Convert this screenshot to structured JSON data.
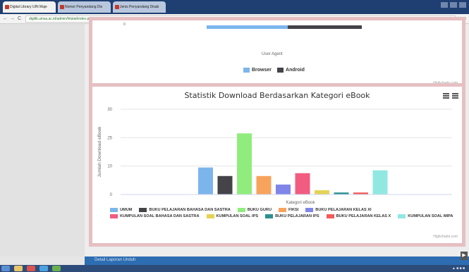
{
  "browser": {
    "tabs": [
      {
        "label": "Digital Library UIN Maje"
      },
      {
        "label": "Nomor Penyandang Dis"
      },
      {
        "label": "Jenis Penyandang Disab"
      }
    ],
    "url": "digilib.uinsa.ac.id/admin/hitstat/index.php?id=98#download",
    "nav": {
      "back": "←",
      "forward": "→",
      "reload": "C"
    },
    "url_icons": "☆ ≡"
  },
  "top_chart": {
    "tick": "0",
    "axis_label": "User Agent",
    "legend": [
      {
        "label": "Browser",
        "color": "#7cb5ec"
      },
      {
        "label": "Android",
        "color": "#434348"
      }
    ],
    "credits": "Highcharts.com"
  },
  "chart_data": {
    "type": "bar",
    "title": "Statistik Download Berdasarkan Kategori eBook",
    "xlabel": "Kategori eBook",
    "ylabel": "Jumlah Download eBook",
    "ylim": [
      0,
      30
    ],
    "yticks": [
      "30",
      "25",
      "10",
      "0"
    ],
    "grid": true,
    "legend_position": "bottom",
    "series": [
      {
        "name": "UMUM",
        "value": 9.5,
        "color": "#7cb5ec"
      },
      {
        "name": "BUKU PELAJARAN BAHASA DAN SASTRA",
        "value": 6.5,
        "color": "#434348"
      },
      {
        "name": "BUKU GURU",
        "value": 21.5,
        "color": "#90ed7d"
      },
      {
        "name": "FIKSI",
        "value": 6.5,
        "color": "#f7a35c"
      },
      {
        "name": "BUKU PELAJARAN KELAS XI",
        "value": 3.5,
        "color": "#8085e9"
      },
      {
        "name": "KUMPULAN SOAL BAHASA DAN SASTRA",
        "value": 7.5,
        "color": "#f15c80"
      },
      {
        "name": "KUMPULAN SOAL IPS",
        "value": 1.5,
        "color": "#e4d354"
      },
      {
        "name": "BUKU PELAJARAN IPS",
        "value": 0.7,
        "color": "#2b908f"
      },
      {
        "name": "BUKU PELAJARAN KELAS X",
        "value": 0.7,
        "color": "#f45b5b"
      },
      {
        "name": "KUMPULAN SOAL MIPA",
        "value": 8.5,
        "color": "#91e8e1"
      }
    ],
    "credits": "Highcharts.com"
  },
  "bottom_strip": {
    "label": "Detail Laporan Unduh"
  },
  "taskbar": {
    "clock": "▲ ■ ■ ■"
  },
  "scroll": {
    "arrow": "▶"
  }
}
